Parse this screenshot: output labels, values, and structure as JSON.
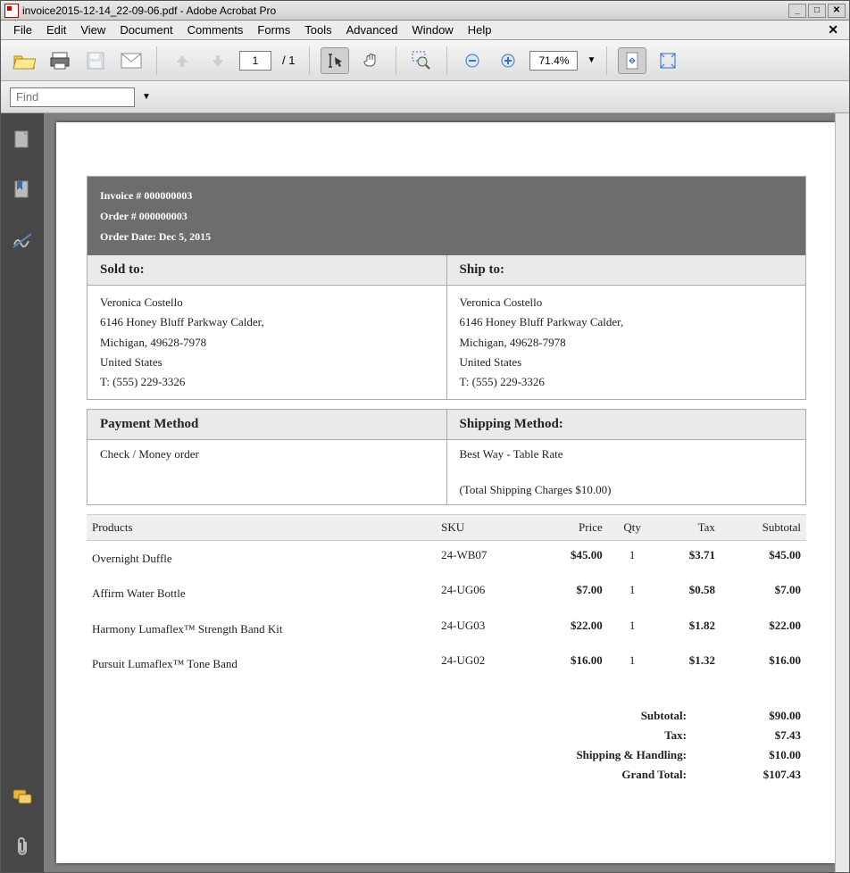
{
  "window": {
    "title": "invoice2015-12-14_22-09-06.pdf - Adobe Acrobat Pro"
  },
  "menu": {
    "items": [
      "File",
      "Edit",
      "View",
      "Document",
      "Comments",
      "Forms",
      "Tools",
      "Advanced",
      "Window",
      "Help"
    ]
  },
  "toolbar": {
    "current_page": "1",
    "page_total": "/ 1",
    "zoom": "71.4%"
  },
  "find": {
    "placeholder": "Find"
  },
  "invoice": {
    "header": {
      "invoice_no": "Invoice # 000000003",
      "order_no": "Order # 000000003",
      "order_date": "Order Date: Dec 5, 2015"
    },
    "sold_to_label": "Sold to:",
    "ship_to_label": "Ship to:",
    "sold_to": {
      "name": "Veronica Costello",
      "street": "6146 Honey Bluff Parkway Calder,",
      "region": "Michigan, 49628-7978",
      "country": "United States",
      "phone": "T: (555) 229-3326"
    },
    "ship_to": {
      "name": "Veronica Costello",
      "street": "6146 Honey Bluff Parkway Calder,",
      "region": "Michigan, 49628-7978",
      "country": "United States",
      "phone": "T: (555) 229-3326"
    },
    "payment_label": "Payment Method",
    "shipping_label": "Shipping Method:",
    "payment_method": "Check / Money order",
    "shipping_method": "Best Way - Table Rate",
    "shipping_charges": "(Total Shipping Charges $10.00)",
    "columns": {
      "products": "Products",
      "sku": "SKU",
      "price": "Price",
      "qty": "Qty",
      "tax": "Tax",
      "subtotal": "Subtotal"
    },
    "items": [
      {
        "name": "Overnight Duffle",
        "sku": "24-WB07",
        "price": "$45.00",
        "qty": "1",
        "tax": "$3.71",
        "subtotal": "$45.00"
      },
      {
        "name": "Affirm Water Bottle",
        "sku": "24-UG06",
        "price": "$7.00",
        "qty": "1",
        "tax": "$0.58",
        "subtotal": "$7.00"
      },
      {
        "name": "Harmony Lumaflex&trade; Strength Band Kit",
        "sku": "24-UG03",
        "price": "$22.00",
        "qty": "1",
        "tax": "$1.82",
        "subtotal": "$22.00"
      },
      {
        "name": "Pursuit Lumaflex&trade; Tone Band",
        "sku": "24-UG02",
        "price": "$16.00",
        "qty": "1",
        "tax": "$1.32",
        "subtotal": "$16.00"
      }
    ],
    "totals": {
      "subtotal_label": "Subtotal:",
      "subtotal": "$90.00",
      "tax_label": "Tax:",
      "tax": "$7.43",
      "shipping_label": "Shipping & Handling:",
      "shipping": "$10.00",
      "grand_label": "Grand Total:",
      "grand": "$107.43"
    }
  }
}
